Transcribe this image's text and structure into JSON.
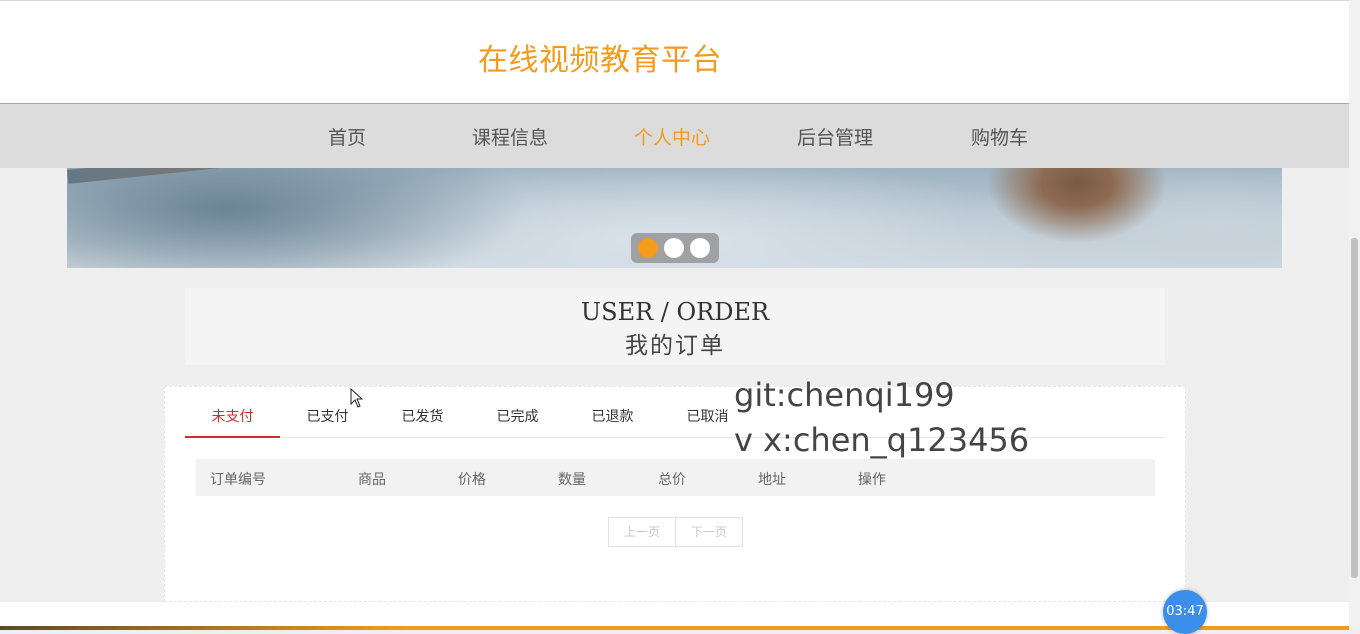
{
  "header": {
    "site_title": "在线视频教育平台"
  },
  "nav": {
    "items": [
      {
        "label": "首页"
      },
      {
        "label": "课程信息"
      },
      {
        "label": "个人中心",
        "active": true
      },
      {
        "label": "后台管理"
      },
      {
        "label": "购物车"
      }
    ]
  },
  "carousel": {
    "slide_count": 3,
    "active_index": 0
  },
  "section": {
    "title_en": "USER / ORDER",
    "title_cn": "我的订单"
  },
  "orders": {
    "tabs": [
      {
        "label": "未支付",
        "active": true
      },
      {
        "label": "已支付"
      },
      {
        "label": "已发货"
      },
      {
        "label": "已完成"
      },
      {
        "label": "已退款"
      },
      {
        "label": "已取消"
      }
    ],
    "columns": [
      "订单编号",
      "商品",
      "价格",
      "数量",
      "总价",
      "地址",
      "操作"
    ],
    "rows": [],
    "pager": {
      "prev": "上一页",
      "next": "下一页"
    }
  },
  "watermark": {
    "line1": "git:chenqi199",
    "line2": "v x:chen_q123456"
  },
  "timer": {
    "label": "03:47"
  },
  "colors": {
    "accent": "#f29b1d",
    "active_tab": "#c9302c",
    "timer": "#3b8fea"
  }
}
